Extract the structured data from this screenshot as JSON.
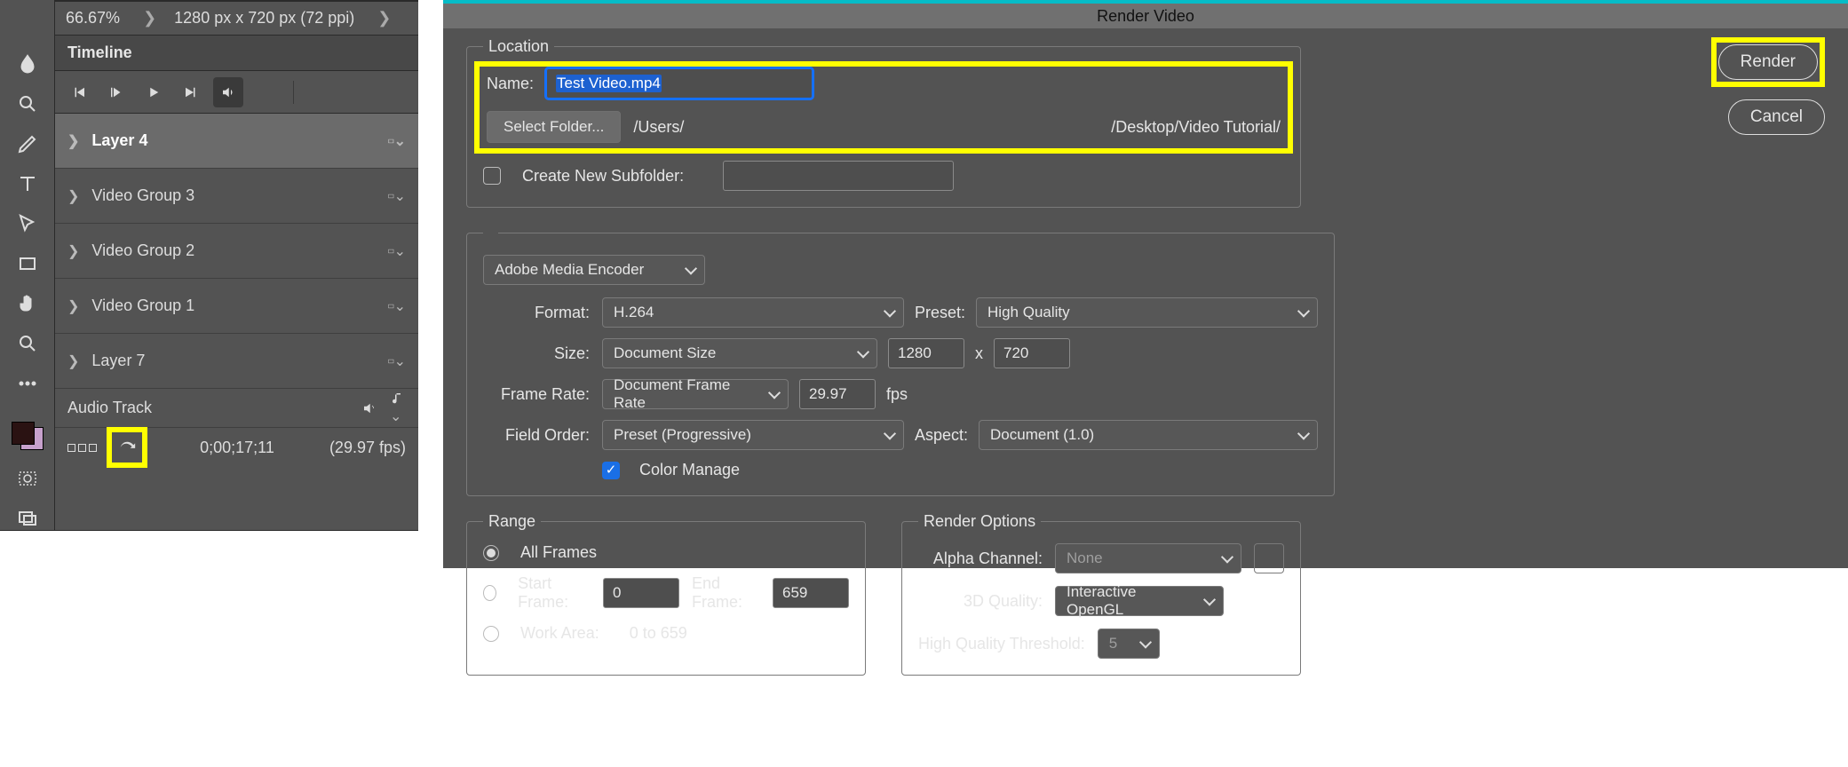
{
  "left": {
    "zoom": "66.67%",
    "canvas_info": "1280 px x 720 px (72 ppi)",
    "panel_title": "Timeline",
    "layers": [
      {
        "name": "Layer 4",
        "selected": true
      },
      {
        "name": "Video Group 3",
        "selected": false
      },
      {
        "name": "Video Group 2",
        "selected": false
      },
      {
        "name": "Video Group 1",
        "selected": false
      },
      {
        "name": "Layer 7",
        "selected": false
      }
    ],
    "audio_label": "Audio Track",
    "timecode": "0;00;17;11",
    "fps_label": "(29.97 fps)"
  },
  "dialog": {
    "title": "Render Video",
    "render_btn": "Render",
    "cancel_btn": "Cancel",
    "location": {
      "legend": "Location",
      "name_label": "Name:",
      "name_value": "Test Video.mp4",
      "select_folder_btn": "Select Folder...",
      "path_pre": "/Users/",
      "path_post": "/Desktop/Video Tutorial/",
      "create_subfolder_label": "Create New Subfolder:"
    },
    "encoder": {
      "engine": "Adobe Media Encoder",
      "format_label": "Format:",
      "format_value": "H.264",
      "preset_label": "Preset:",
      "preset_value": "High Quality",
      "size_label": "Size:",
      "size_value": "Document Size",
      "width": "1280",
      "x": "x",
      "height": "720",
      "framerate_label": "Frame Rate:",
      "framerate_mode": "Document Frame Rate",
      "framerate_value": "29.97",
      "fps_unit": "fps",
      "fieldorder_label": "Field Order:",
      "fieldorder_value": "Preset (Progressive)",
      "aspect_label": "Aspect:",
      "aspect_value": "Document (1.0)",
      "color_manage_label": "Color Manage"
    },
    "range": {
      "legend": "Range",
      "all_frames": "All Frames",
      "start_frame_label": "Start Frame:",
      "start_frame_value": "0",
      "end_frame_label": "End Frame:",
      "end_frame_value": "659",
      "work_area_label": "Work Area:",
      "work_area_value": "0 to 659"
    },
    "options": {
      "legend": "Render Options",
      "alpha_label": "Alpha Channel:",
      "alpha_value": "None",
      "quality3d_label": "3D Quality:",
      "quality3d_value": "Interactive OpenGL",
      "hq_threshold_label": "High Quality Threshold:",
      "hq_threshold_value": "5"
    }
  }
}
